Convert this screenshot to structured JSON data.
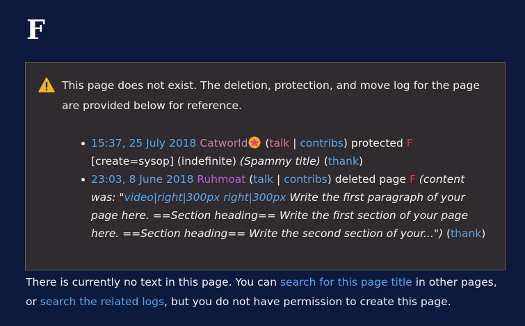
{
  "page": {
    "title": "F"
  },
  "notice": {
    "text": "This page does not exist. The deletion, protection, and move log for the page are provided below for reference."
  },
  "log": [
    {
      "time": "15:37, 25 July 2018",
      "user": "Catworld",
      "user_color": "#c281a8",
      "badge_icon": "star-badge-icon",
      "talk": "talk",
      "contribs": "contribs",
      "action": "protected",
      "target": "F",
      "settings": "[create=sysop]",
      "expiry": "(indefinite)",
      "reason": "(Spammy title)",
      "thank": "thank"
    },
    {
      "time": "23:03, 8 June 2018",
      "user": "Ruhmoat",
      "user_color": "#b35fe0",
      "talk": "talk",
      "contribs": "contribs",
      "action": "deleted page",
      "target": "F",
      "reason_prefix": "(content was: \"",
      "reason_link": "video|right|300px right|300px",
      "reason_rest": " Write the first paragraph of your page here. ==Section heading== Write the first section of your page here. ==Section heading== Write the second section of your...\")",
      "thank": "thank"
    }
  ],
  "footer": {
    "part1": "There is currently no text in this page. You can ",
    "link1": "search for this page title",
    "part2": " in other pages, or ",
    "link2": "search the related logs",
    "part3": ", but you do not have permission to create this page."
  },
  "colors": {
    "background": "#0b1a3d",
    "box": "#2f2b2e",
    "link": "#5aa7ec",
    "redlink": "#e23b3b",
    "warning": "#f0b429"
  }
}
